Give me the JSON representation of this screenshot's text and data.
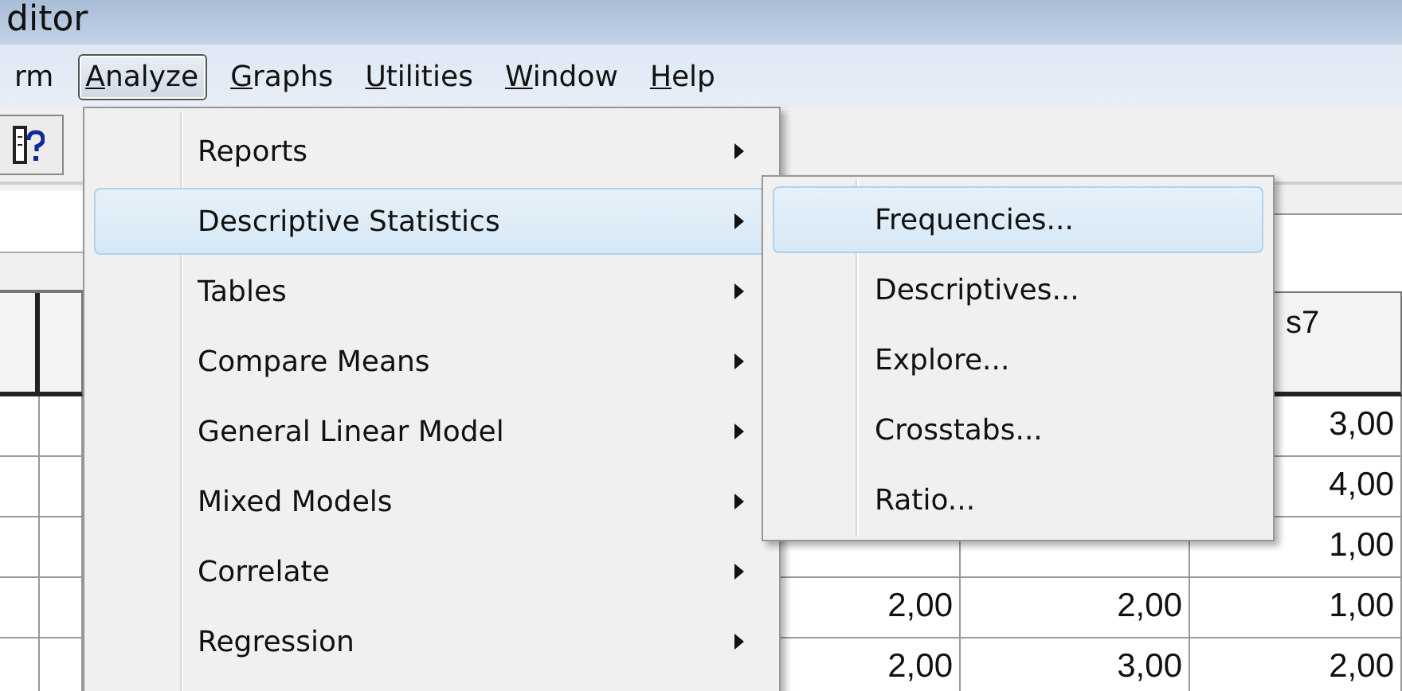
{
  "window": {
    "title": "ditor"
  },
  "menubar": [
    {
      "label": "rm",
      "selected": false
    },
    {
      "key": "A",
      "label": "nalyze",
      "selected": true
    },
    {
      "key": "G",
      "label": "raphs",
      "selected": false
    },
    {
      "key": "U",
      "label": "tilities",
      "selected": false
    },
    {
      "key": "W",
      "label": "indow",
      "selected": false
    },
    {
      "key": "H",
      "label": "elp",
      "selected": false
    }
  ],
  "grid": {
    "columns": [
      null,
      null,
      null,
      null,
      null,
      "s7"
    ],
    "rows": [
      [
        null,
        null,
        null,
        null,
        null,
        "3,00"
      ],
      [
        null,
        null,
        null,
        null,
        null,
        "4,00"
      ],
      [
        null,
        null,
        null,
        null,
        null,
        "1,00"
      ],
      [
        null,
        null,
        null,
        "2,00",
        "2,00",
        "1,00"
      ],
      [
        null,
        null,
        null,
        "2,00",
        "3,00",
        "2,00"
      ]
    ]
  },
  "analyze_menu": [
    {
      "label": "Reports",
      "has_submenu": true,
      "selected": false
    },
    {
      "label": "Descriptive Statistics",
      "has_submenu": true,
      "selected": true
    },
    {
      "label": "Tables",
      "has_submenu": true,
      "selected": false
    },
    {
      "label": "Compare Means",
      "has_submenu": true,
      "selected": false
    },
    {
      "label": "General Linear Model",
      "has_submenu": true,
      "selected": false
    },
    {
      "label": "Mixed Models",
      "has_submenu": true,
      "selected": false
    },
    {
      "label": "Correlate",
      "has_submenu": true,
      "selected": false
    },
    {
      "label": "Regression",
      "has_submenu": true,
      "selected": false
    }
  ],
  "submenu": [
    {
      "label": "Frequencies...",
      "selected": true
    },
    {
      "label": "Descriptives...",
      "selected": false
    },
    {
      "label": "Explore...",
      "selected": false
    },
    {
      "label": "Crosstabs...",
      "selected": false
    },
    {
      "label": "Ratio...",
      "selected": false
    }
  ]
}
